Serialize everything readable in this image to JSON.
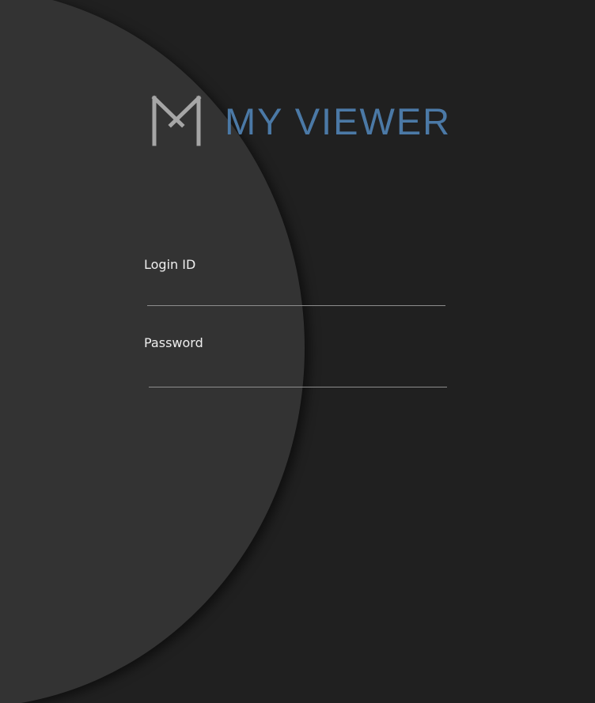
{
  "app": {
    "brand_name": "MY VIEWER",
    "logo_icon": "m-monogram-icon",
    "colors": {
      "background": "#202020",
      "circle_panel": "#333333",
      "brand": "#4b79a6",
      "logo_mark": "#a6a6a6",
      "label_text": "#efefef",
      "underline": "#8d8d8d"
    }
  },
  "login_form": {
    "login_id": {
      "label": "Login ID",
      "value": ""
    },
    "password": {
      "label": "Password",
      "value": ""
    }
  }
}
